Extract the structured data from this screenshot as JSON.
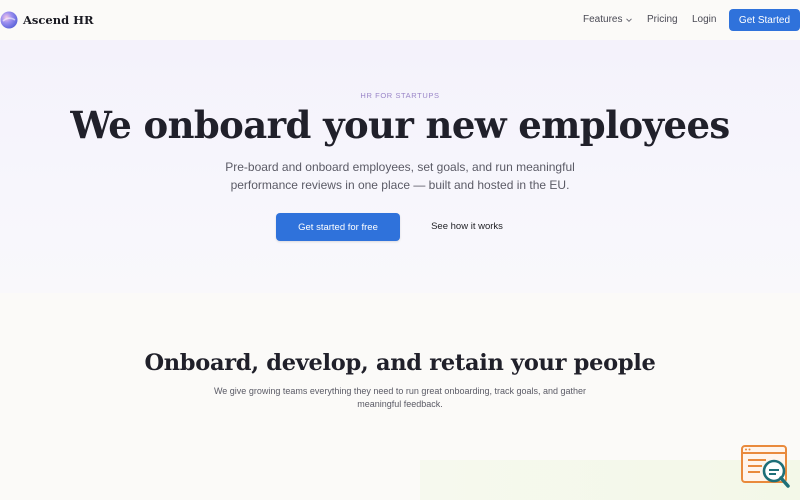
{
  "nav": {
    "brand": "Ascend HR",
    "links": {
      "features": "Features",
      "pricing": "Pricing",
      "login": "Login"
    },
    "cta": "Get Started"
  },
  "hero": {
    "eyebrow": "HR FOR STARTUPS",
    "title": "We onboard your new employees",
    "subtitle": "Pre-board and onboard employees, set goals, and run meaningful performance reviews in one place — built and hosted in the EU.",
    "primary_button": "Get started for free",
    "secondary_button": "See how it works"
  },
  "section2": {
    "title": "Onboard, develop, and retain your people",
    "subtitle": "We give growing teams everything they need to run great onboarding, track goals, and gather meaningful feedback."
  },
  "colors": {
    "accent": "#2f72db",
    "eyebrow": "#9a86c8",
    "widget_orange": "#e98a3c",
    "widget_teal": "#1e6f78"
  },
  "icons": {
    "logo": "gradient-orb-logo",
    "features_chevron": "chevron-down-icon",
    "widget": "search-document-icon"
  }
}
